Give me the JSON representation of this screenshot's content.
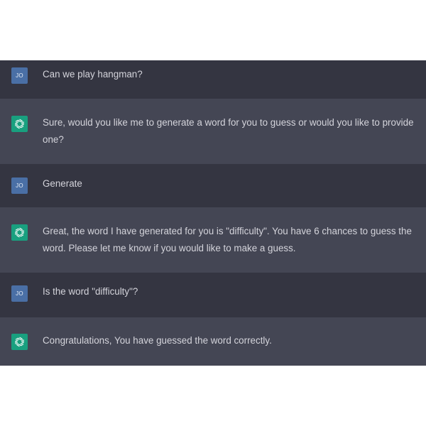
{
  "conversation": {
    "user_initials": "JO",
    "messages": [
      {
        "role": "user",
        "text": "Can we play hangman?"
      },
      {
        "role": "assistant",
        "text": "Sure, would you like me to generate a word for you to guess or would you like to provide one?"
      },
      {
        "role": "user",
        "text": "Generate"
      },
      {
        "role": "assistant",
        "text": "Great, the word I have generated for you is \"difficulty\". You have 6 chances to guess the word. Please let me know if you would like to make a guess."
      },
      {
        "role": "user",
        "text": "Is the word \"difficulty\"?"
      },
      {
        "role": "assistant",
        "text": "Congratulations, You have guessed the word correctly."
      }
    ]
  },
  "icons": {
    "user_avatar": "user-avatar",
    "assistant_avatar": "openai-logo-icon"
  },
  "colors": {
    "user_bg": "#343541",
    "assistant_bg": "#444654",
    "user_avatar_bg": "#4a6fa5",
    "assistant_avatar_bg": "#19a07f",
    "text": "#d4d4db"
  }
}
